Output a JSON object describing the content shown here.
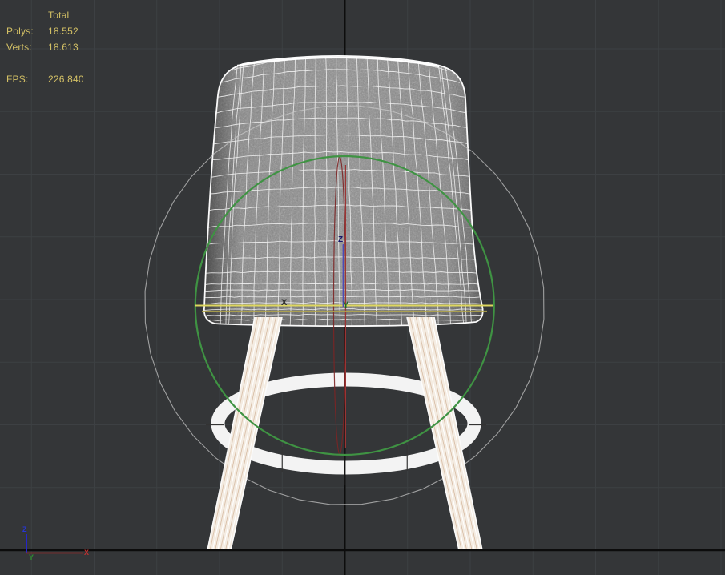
{
  "viewport": {
    "stats": {
      "header": "Total",
      "polys_label": "Polys:",
      "polys_value": "18.552",
      "verts_label": "Verts:",
      "verts_value": "18.613",
      "fps_label": "FPS:",
      "fps_value": "226,840"
    },
    "gizmo_labels": {
      "x": "X",
      "y": "Y",
      "z": "Z"
    },
    "nav_axis_labels": {
      "x": "X",
      "y": "Y",
      "z": "Z"
    },
    "colors": {
      "background": "#343638",
      "grid_line": "#3d4043",
      "world_axis_black": "#0d0d0d",
      "stats_text": "#d3c065",
      "rotate_gizmo_x_red": "#7c2525",
      "rotate_gizmo_y_green": "#3f9343",
      "rotate_gizmo_active_yellow": "#ded75f",
      "screen_circle_gray": "#c9c9c9",
      "move_axis_z_blue": "#4a4ab8",
      "model_wireframe_white": "#f0f0f0",
      "leg_fill_cream": "#f4ece2",
      "leg_streak_tan": "#d9bfa8",
      "footrest_ring_white": "#f3f3f3"
    }
  }
}
